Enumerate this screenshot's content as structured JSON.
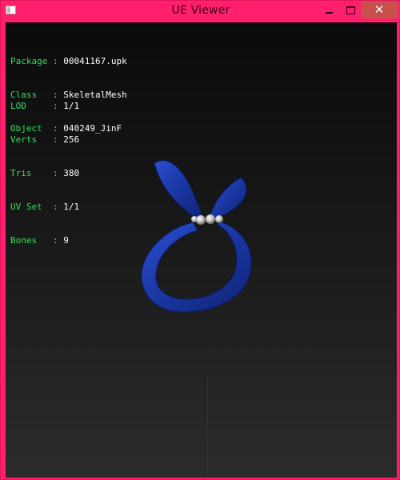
{
  "window": {
    "title": "UE Viewer",
    "controls": {
      "minimize": "",
      "maximize": "",
      "close": "✕"
    }
  },
  "info_header": [
    {
      "key": "Package",
      "sep": ":",
      "value": "00041167.upk"
    },
    {
      "key": "Class  ",
      "sep": ":",
      "value": "SkeletalMesh"
    },
    {
      "key": "Object ",
      "sep": ":",
      "value": "040249_JinF"
    }
  ],
  "info_stats": [
    {
      "key": "LOD    ",
      "sep": ":",
      "value": "1/1"
    },
    {
      "key": "Verts  ",
      "sep": ":",
      "value": "256"
    },
    {
      "key": "Tris   ",
      "sep": ":",
      "value": "380"
    },
    {
      "key": "UV Set ",
      "sep": ":",
      "value": "1/1"
    },
    {
      "key": "Bones  ",
      "sep": ":",
      "value": "9"
    }
  ],
  "colors": {
    "title_bar": "#ff1f6d",
    "label": "#2ee05a",
    "value": "#ffffff",
    "mesh": "#1f3fae",
    "axis": "#1822c8"
  }
}
